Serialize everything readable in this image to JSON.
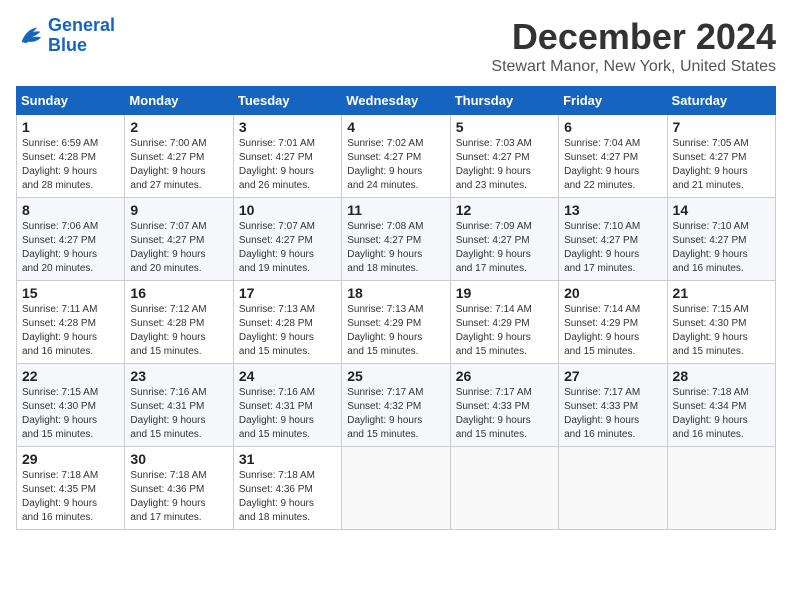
{
  "header": {
    "logo_line1": "General",
    "logo_line2": "Blue",
    "month": "December 2024",
    "location": "Stewart Manor, New York, United States"
  },
  "weekdays": [
    "Sunday",
    "Monday",
    "Tuesday",
    "Wednesday",
    "Thursday",
    "Friday",
    "Saturday"
  ],
  "weeks": [
    [
      {
        "day": "1",
        "info": "Sunrise: 6:59 AM\nSunset: 4:28 PM\nDaylight: 9 hours\nand 28 minutes."
      },
      {
        "day": "2",
        "info": "Sunrise: 7:00 AM\nSunset: 4:27 PM\nDaylight: 9 hours\nand 27 minutes."
      },
      {
        "day": "3",
        "info": "Sunrise: 7:01 AM\nSunset: 4:27 PM\nDaylight: 9 hours\nand 26 minutes."
      },
      {
        "day": "4",
        "info": "Sunrise: 7:02 AM\nSunset: 4:27 PM\nDaylight: 9 hours\nand 24 minutes."
      },
      {
        "day": "5",
        "info": "Sunrise: 7:03 AM\nSunset: 4:27 PM\nDaylight: 9 hours\nand 23 minutes."
      },
      {
        "day": "6",
        "info": "Sunrise: 7:04 AM\nSunset: 4:27 PM\nDaylight: 9 hours\nand 22 minutes."
      },
      {
        "day": "7",
        "info": "Sunrise: 7:05 AM\nSunset: 4:27 PM\nDaylight: 9 hours\nand 21 minutes."
      }
    ],
    [
      {
        "day": "8",
        "info": "Sunrise: 7:06 AM\nSunset: 4:27 PM\nDaylight: 9 hours\nand 20 minutes."
      },
      {
        "day": "9",
        "info": "Sunrise: 7:07 AM\nSunset: 4:27 PM\nDaylight: 9 hours\nand 20 minutes."
      },
      {
        "day": "10",
        "info": "Sunrise: 7:07 AM\nSunset: 4:27 PM\nDaylight: 9 hours\nand 19 minutes."
      },
      {
        "day": "11",
        "info": "Sunrise: 7:08 AM\nSunset: 4:27 PM\nDaylight: 9 hours\nand 18 minutes."
      },
      {
        "day": "12",
        "info": "Sunrise: 7:09 AM\nSunset: 4:27 PM\nDaylight: 9 hours\nand 17 minutes."
      },
      {
        "day": "13",
        "info": "Sunrise: 7:10 AM\nSunset: 4:27 PM\nDaylight: 9 hours\nand 17 minutes."
      },
      {
        "day": "14",
        "info": "Sunrise: 7:10 AM\nSunset: 4:27 PM\nDaylight: 9 hours\nand 16 minutes."
      }
    ],
    [
      {
        "day": "15",
        "info": "Sunrise: 7:11 AM\nSunset: 4:28 PM\nDaylight: 9 hours\nand 16 minutes."
      },
      {
        "day": "16",
        "info": "Sunrise: 7:12 AM\nSunset: 4:28 PM\nDaylight: 9 hours\nand 15 minutes."
      },
      {
        "day": "17",
        "info": "Sunrise: 7:13 AM\nSunset: 4:28 PM\nDaylight: 9 hours\nand 15 minutes."
      },
      {
        "day": "18",
        "info": "Sunrise: 7:13 AM\nSunset: 4:29 PM\nDaylight: 9 hours\nand 15 minutes."
      },
      {
        "day": "19",
        "info": "Sunrise: 7:14 AM\nSunset: 4:29 PM\nDaylight: 9 hours\nand 15 minutes."
      },
      {
        "day": "20",
        "info": "Sunrise: 7:14 AM\nSunset: 4:29 PM\nDaylight: 9 hours\nand 15 minutes."
      },
      {
        "day": "21",
        "info": "Sunrise: 7:15 AM\nSunset: 4:30 PM\nDaylight: 9 hours\nand 15 minutes."
      }
    ],
    [
      {
        "day": "22",
        "info": "Sunrise: 7:15 AM\nSunset: 4:30 PM\nDaylight: 9 hours\nand 15 minutes."
      },
      {
        "day": "23",
        "info": "Sunrise: 7:16 AM\nSunset: 4:31 PM\nDaylight: 9 hours\nand 15 minutes."
      },
      {
        "day": "24",
        "info": "Sunrise: 7:16 AM\nSunset: 4:31 PM\nDaylight: 9 hours\nand 15 minutes."
      },
      {
        "day": "25",
        "info": "Sunrise: 7:17 AM\nSunset: 4:32 PM\nDaylight: 9 hours\nand 15 minutes."
      },
      {
        "day": "26",
        "info": "Sunrise: 7:17 AM\nSunset: 4:33 PM\nDaylight: 9 hours\nand 15 minutes."
      },
      {
        "day": "27",
        "info": "Sunrise: 7:17 AM\nSunset: 4:33 PM\nDaylight: 9 hours\nand 16 minutes."
      },
      {
        "day": "28",
        "info": "Sunrise: 7:18 AM\nSunset: 4:34 PM\nDaylight: 9 hours\nand 16 minutes."
      }
    ],
    [
      {
        "day": "29",
        "info": "Sunrise: 7:18 AM\nSunset: 4:35 PM\nDaylight: 9 hours\nand 16 minutes."
      },
      {
        "day": "30",
        "info": "Sunrise: 7:18 AM\nSunset: 4:36 PM\nDaylight: 9 hours\nand 17 minutes."
      },
      {
        "day": "31",
        "info": "Sunrise: 7:18 AM\nSunset: 4:36 PM\nDaylight: 9 hours\nand 18 minutes."
      },
      {
        "day": "",
        "info": ""
      },
      {
        "day": "",
        "info": ""
      },
      {
        "day": "",
        "info": ""
      },
      {
        "day": "",
        "info": ""
      }
    ]
  ]
}
